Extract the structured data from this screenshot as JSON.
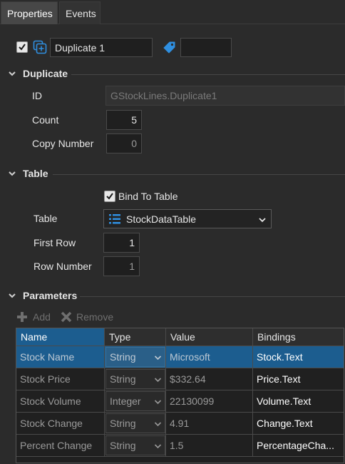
{
  "tabs": [
    {
      "label": "Properties"
    },
    {
      "label": "Events"
    }
  ],
  "header": {
    "name_value": "Duplicate 1",
    "tag_value": ""
  },
  "duplicate": {
    "title": "Duplicate",
    "id_label": "ID",
    "id_value": "GStockLines.Duplicate1",
    "count_label": "Count",
    "count_value": "5",
    "copy_number_label": "Copy Number",
    "copy_number_value": "0"
  },
  "table": {
    "title": "Table",
    "bind_label": "Bind To Table",
    "table_label": "Table",
    "table_value": "StockDataTable",
    "first_row_label": "First Row",
    "first_row_value": "1",
    "row_number_label": "Row Number",
    "row_number_value": "1"
  },
  "parameters": {
    "title": "Parameters",
    "add_label": "Add",
    "remove_label": "Remove",
    "columns": [
      "Name",
      "Type",
      "Value",
      "Bindings"
    ],
    "rows": [
      {
        "name": "Stock Name",
        "type": "String",
        "value": "Microsoft",
        "binding": "Stock.Text"
      },
      {
        "name": "Stock Price",
        "type": "String",
        "value": "$332.64",
        "binding": "Price.Text"
      },
      {
        "name": "Stock Volume",
        "type": "Integer",
        "value": "22130099",
        "binding": "Volume.Text"
      },
      {
        "name": "Stock Change",
        "type": "String",
        "value": "4.91",
        "binding": "Change.Text"
      },
      {
        "name": "Percent Change",
        "type": "String",
        "value": "1.5",
        "binding": "PercentageCha..."
      }
    ]
  },
  "colors": {
    "background": "#2b2b2b",
    "accent": "#1c5d8f",
    "icon_blue": "#2f8fe0"
  }
}
